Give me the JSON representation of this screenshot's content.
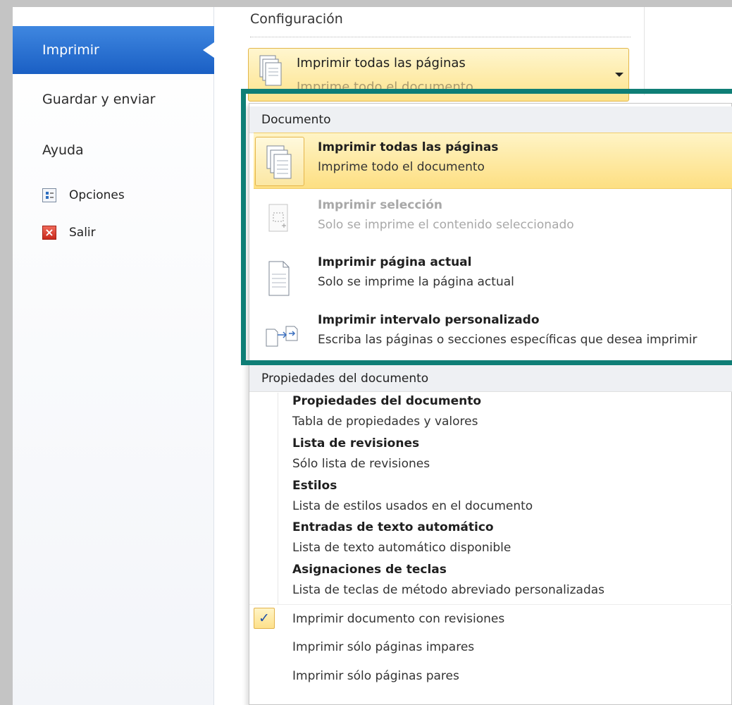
{
  "nav": {
    "imprimir": "Imprimir",
    "guardar": "Guardar y enviar",
    "ayuda": "Ayuda",
    "opciones": "Opciones",
    "salir": "Salir"
  },
  "config": {
    "title": "Configuración",
    "combo_main": "Imprimir todas las páginas",
    "combo_sub": "Imprime todo el documento"
  },
  "dropdown": {
    "doc_header": "Documento",
    "options": [
      {
        "title": "Imprimir todas las páginas",
        "desc": "Imprime todo el documento"
      },
      {
        "title": "Imprimir selección",
        "desc": "Solo se imprime el contenido seleccionado"
      },
      {
        "title": "Imprimir página actual",
        "desc": "Solo se imprime la página actual"
      },
      {
        "title": "Imprimir intervalo personalizado",
        "desc": "Escriba las páginas o secciones específicas que desea imprimir"
      }
    ],
    "props_header": "Propiedades del documento",
    "props": [
      {
        "title": "Propiedades del documento",
        "desc": "Tabla de propiedades y valores"
      },
      {
        "title": "Lista de revisiones",
        "desc": "Sólo lista de revisiones"
      },
      {
        "title": "Estilos",
        "desc": "Lista de estilos usados en el documento"
      },
      {
        "title": "Entradas de texto automático",
        "desc": "Lista de texto automático disponible"
      },
      {
        "title": "Asignaciones de teclas",
        "desc": "Lista de teclas de método abreviado personalizadas"
      }
    ],
    "toggles": [
      {
        "label": "Imprimir documento con revisiones",
        "checked": true
      },
      {
        "label": "Imprimir sólo páginas impares",
        "checked": false
      },
      {
        "label": "Imprimir sólo páginas pares",
        "checked": false
      }
    ],
    "check_glyph": "✓"
  },
  "colors": {
    "nav_selected": "#1a5fc4",
    "highlight": "#fddf82",
    "annotation": "#0f7e76"
  }
}
